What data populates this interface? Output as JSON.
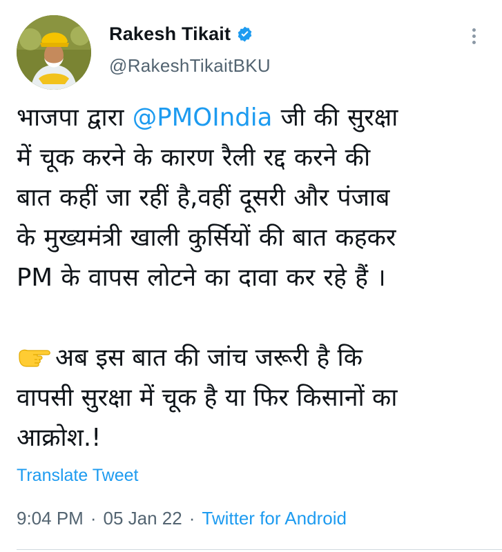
{
  "author": {
    "name": "Rakesh Tikait",
    "handle": "@RakeshTikaitBKU",
    "verified": true
  },
  "tweet": {
    "line1_pre": "भाजपा द्वारा ",
    "mention": "@PMOIndia",
    "line1_post": " जी की सुरक्षा",
    "lines": [
      "में चूक करने के कारण रैली रद्द करने की",
      "बात कहीं जा रहीं है,वहीं दूसरी और पंजाब",
      "के मुख्यमंत्री खाली कुर्सियों की बात कहकर",
      "PM के वापस लोटने का दावा कर रहे हैं ।"
    ],
    "para2": [
      "अब इस बात की जांच जरूरी है कि",
      "वापसी सुरक्षा में चूक है या फिर किसानों का",
      "आक्रोश.!"
    ]
  },
  "translate_label": "Translate Tweet",
  "meta": {
    "time": "9:04 PM",
    "sep": "·",
    "date": "05 Jan 22",
    "source": "Twitter for Android"
  },
  "colors": {
    "link": "#1d9bf0",
    "secondary": "#536471",
    "text": "#0f1419"
  },
  "icons": {
    "verified": "verified-badge-icon",
    "more": "more-options-icon",
    "emoji": "backhand-index-pointing-right-emoji"
  }
}
